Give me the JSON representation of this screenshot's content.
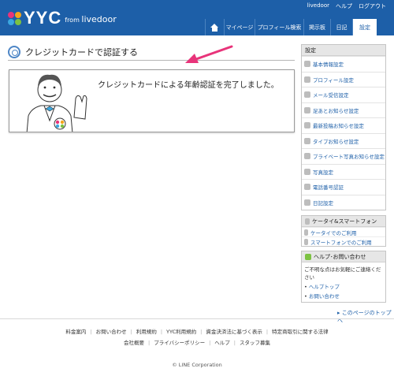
{
  "header": {
    "logo_text": "YYC",
    "logo_from": "from",
    "logo_brand": "livedoor",
    "top_links": [
      "livedoor",
      "ヘルプ",
      "ログアウト"
    ],
    "nav": [
      "マイページ",
      "プロフィール検索",
      "掲示板",
      "日記",
      "設定"
    ],
    "active_nav": "設定"
  },
  "main": {
    "title": "クレジットカードで認証する",
    "message": "クレジットカードによる年齢認証を完了しました。"
  },
  "sidebar": {
    "settings_title": "設定",
    "settings_items": [
      {
        "label": "基本情報設定",
        "icon": "profile-card-icon"
      },
      {
        "label": "プロフィール設定",
        "icon": "person-icon"
      },
      {
        "label": "メール受信設定",
        "icon": "mail-icon"
      },
      {
        "label": "足あとお知らせ設定",
        "icon": "footprint-icon"
      },
      {
        "label": "最新投稿お知らせ設定",
        "icon": "post-icon"
      },
      {
        "label": "タイプお知らせ設定",
        "icon": "heart-icon"
      },
      {
        "label": "プライベート写真お知らせ設定",
        "icon": "private-photo-icon"
      },
      {
        "label": "写真設定",
        "icon": "photo-icon"
      },
      {
        "label": "電話番号認証",
        "icon": "phone-icon"
      },
      {
        "label": "日記設定",
        "icon": "diary-icon"
      }
    ],
    "mobile_title": "ケータイ&スマートフォン",
    "mobile_items": [
      "ケータイでのご利用",
      "スマートフォンでのご利用"
    ],
    "help_title": "ヘルプ･お問い合わせ",
    "help_text": "ご不明な点はお気軽にご連絡ください",
    "help_links": [
      "ヘルプトップ",
      "お問い合わせ"
    ]
  },
  "page_top": "▸ このページのトップへ",
  "footer": {
    "row1": [
      "料金案内",
      "お問い合わせ",
      "利用規約",
      "YYC利用規約",
      "資金決済法に基づく表示",
      "特定商取引に関する法律"
    ],
    "row2": [
      "会社概要",
      "プライバシーポリシー",
      "ヘルプ",
      "スタッフ募集"
    ],
    "copyright": "© LINE Corporation"
  },
  "colors": {
    "header_blue": "#1d5fa8",
    "link_blue": "#1d5fa8",
    "arrow_pink": "#e8347a"
  }
}
